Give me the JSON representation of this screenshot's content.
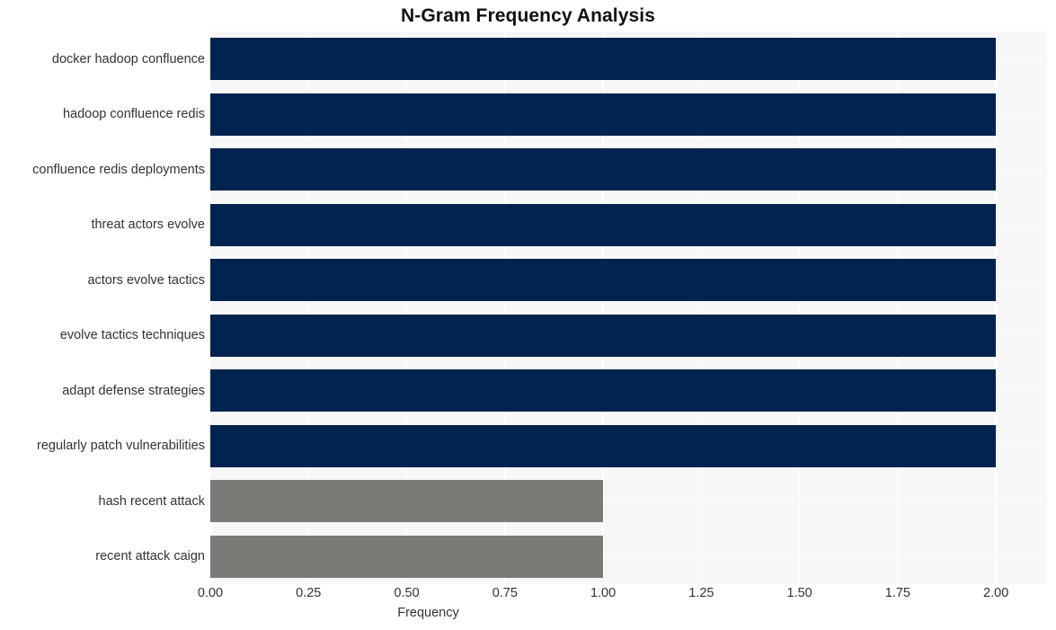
{
  "chart_data": {
    "type": "bar",
    "orientation": "horizontal",
    "title": "N-Gram Frequency Analysis",
    "xlabel": "Frequency",
    "ylabel": "",
    "categories": [
      "docker hadoop confluence",
      "hadoop confluence redis",
      "confluence redis deployments",
      "threat actors evolve",
      "actors evolve tactics",
      "evolve tactics techniques",
      "adapt defense strategies",
      "regularly patch vulnerabilities",
      "hash recent attack",
      "recent attack caign"
    ],
    "values": [
      2,
      2,
      2,
      2,
      2,
      2,
      2,
      2,
      1,
      1
    ],
    "bar_colors": [
      "#00234f",
      "#00234f",
      "#00234f",
      "#00234f",
      "#00234f",
      "#00234f",
      "#00234f",
      "#00234f",
      "#7b7a77",
      "#7b7a77"
    ],
    "xlim": [
      0,
      2.13
    ],
    "xticks": [
      0,
      0.25,
      0.5,
      0.75,
      1,
      1.25,
      1.5,
      1.75,
      2
    ],
    "xtick_labels": [
      "0.00",
      "0.25",
      "0.50",
      "0.75",
      "1.00",
      "1.25",
      "1.50",
      "1.75",
      "2.00"
    ],
    "grid": true,
    "grid_color": "#ffffff",
    "legend": null,
    "plot_background": "#f7f7f7",
    "figure_background": "#ffffff",
    "text_color": "#333333",
    "title_color": "#111111"
  }
}
